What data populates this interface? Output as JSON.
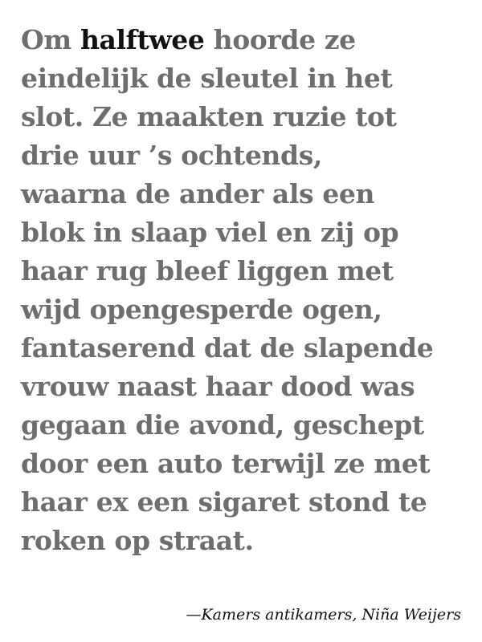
{
  "quote": {
    "highlight": "halftwee",
    "lines": [
      "Om ",
      "eindelijk de sleutel in het",
      "slot. Ze maakten ruzie tot",
      "drie uur ’s ochtends,",
      "waarna de ander als een",
      "blok in slaap viel en zij op",
      "haar rug bleef liggen met",
      "wijd opengesperde ogen,",
      "fantaserend dat de slapende",
      "vrouw naast haar dood was",
      "gegaan die avond, geschept",
      "door een auto terwijl ze met",
      "haar ex een sigaret stond te",
      "roken op straat."
    ],
    "first_line_rest": " hoorde ze"
  },
  "attribution": "—Kamers antikamers, Niña Weijers",
  "colors": {
    "body_text": "#6e6e6e",
    "highlight_text": "#111111",
    "attribution_text": "#111111",
    "background": "#ffffff"
  }
}
